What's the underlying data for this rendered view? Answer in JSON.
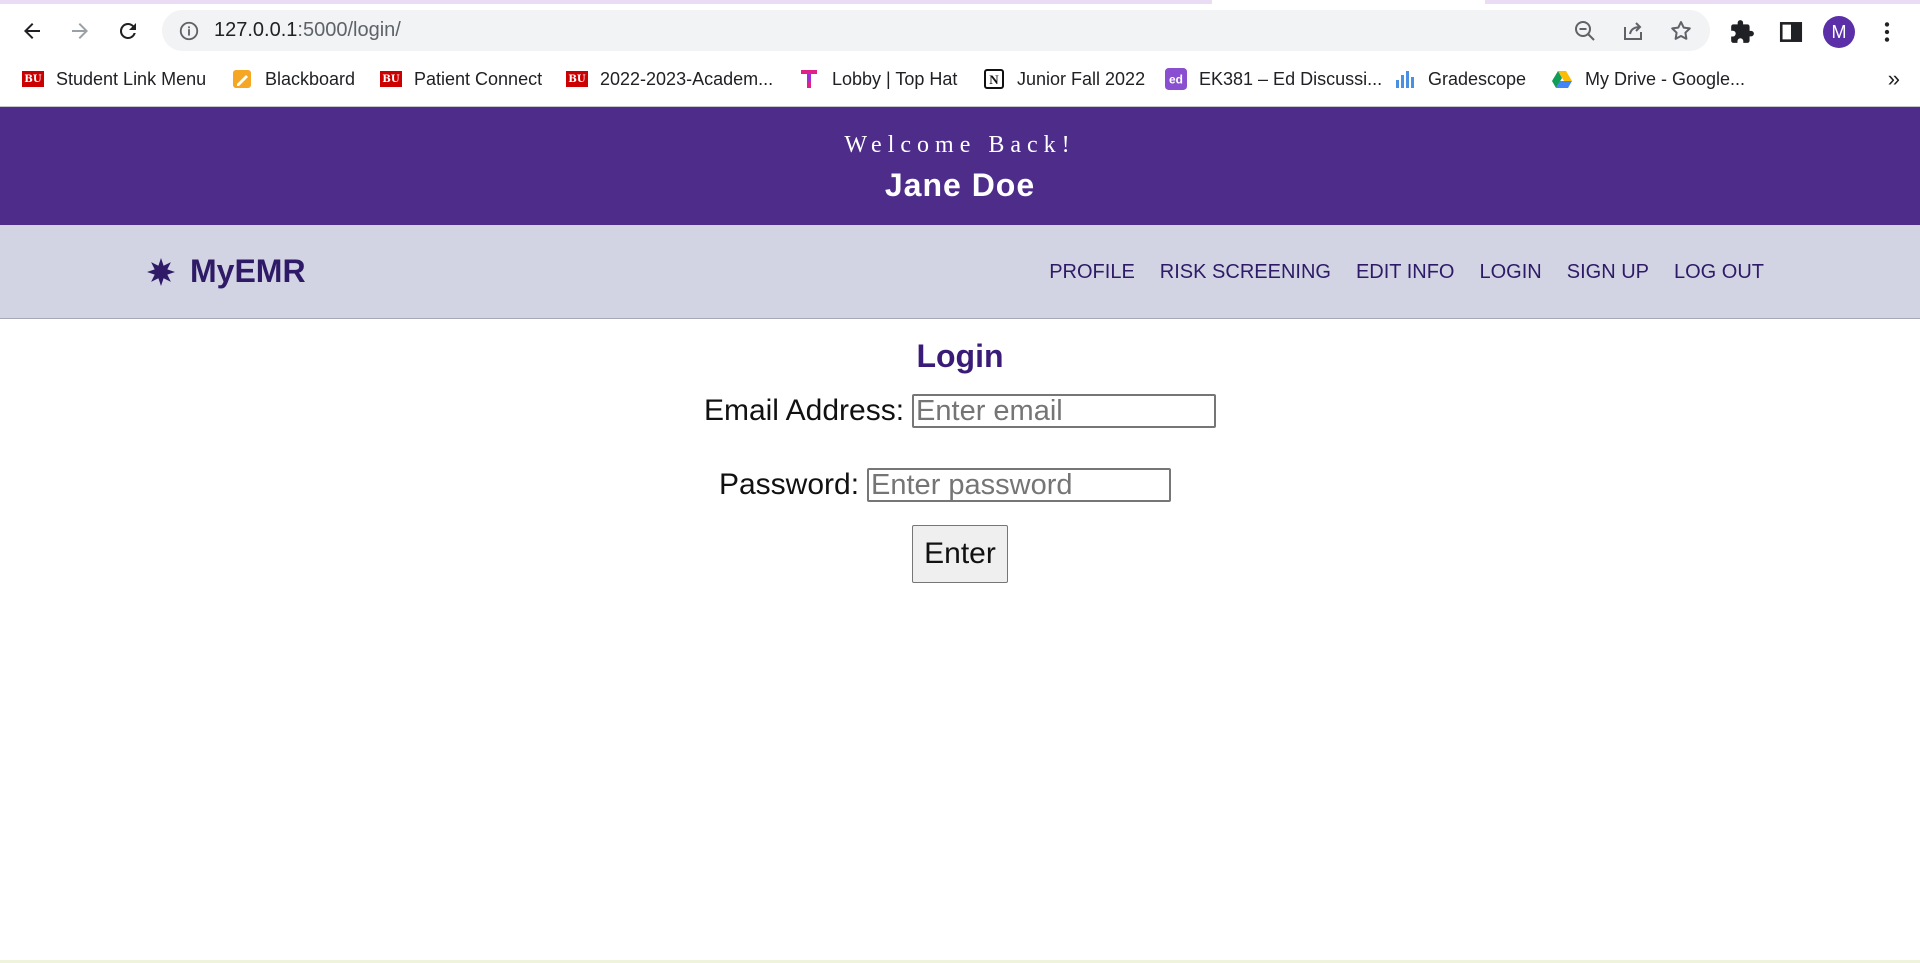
{
  "browser": {
    "url_host": "127.0.0.1",
    "url_rest": ":5000/login/",
    "profile_initial": "M",
    "bookmarks": [
      {
        "label": "Student Link Menu",
        "icon": "bu-icon"
      },
      {
        "label": "Blackboard",
        "icon": "blackboard-icon"
      },
      {
        "label": "Patient Connect",
        "icon": "bu-icon"
      },
      {
        "label": "2022-2023-Academ...",
        "icon": "bu-icon"
      },
      {
        "label": "Lobby | Top Hat",
        "icon": "tophat-icon"
      },
      {
        "label": "Junior Fall 2022",
        "icon": "notion-icon"
      },
      {
        "label": "EK381 – Ed Discussi...",
        "icon": "ed-icon"
      },
      {
        "label": "Gradescope",
        "icon": "gradescope-icon"
      },
      {
        "label": "My Drive - Google...",
        "icon": "google-drive-icon"
      }
    ],
    "bookmarks_more": "»"
  },
  "banner": {
    "welcome": "Welcome Back!",
    "user_name": "Jane Doe",
    "color": "#4e2d8a"
  },
  "navbar": {
    "brand": "MyEMR",
    "links": [
      "PROFILE",
      "RISK SCREENING",
      "EDIT INFO",
      "LOGIN",
      "SIGN UP",
      "LOG OUT"
    ],
    "background": "#d2d4e4"
  },
  "login": {
    "title": "Login",
    "email_label": "Email Address:",
    "email_placeholder": "Enter email",
    "email_value": "",
    "password_label": "Password:",
    "password_placeholder": "Enter password",
    "password_value": "",
    "submit_label": "Enter"
  }
}
